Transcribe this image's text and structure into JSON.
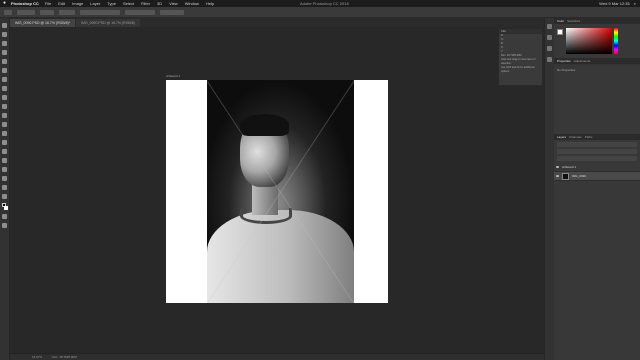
{
  "menubar": {
    "app_name": "Photoshop CC",
    "items": [
      "File",
      "Edit",
      "Image",
      "Layer",
      "Type",
      "Select",
      "Filter",
      "3D",
      "View",
      "Window",
      "Help"
    ],
    "window_title": "Adobe Photoshop CC 2018",
    "clock": "Wed 9 Mar 12:35"
  },
  "tabs": [
    {
      "label": "IMG_0090.PSD @ 16.7% (RGB/8)*"
    },
    {
      "label": "IMG_0090.PSD @ 16.7% (RGB/8)"
    }
  ],
  "artboard": {
    "label": "Artboard 1"
  },
  "info_panel": {
    "title": "Info",
    "rows": [
      "R:",
      "G:",
      "B:",
      "X:",
      "Y:",
      "Doc: 18.7M/8.90M",
      "Click and drag to move layer or selection.",
      "Use Shift and Alt for additional options."
    ]
  },
  "right_panel": {
    "color_tabs": [
      "Color",
      "Swatches"
    ],
    "properties_tabs": [
      "Properties",
      "Adjustments"
    ],
    "properties_text": "No Properties",
    "layers_tabs": [
      "Layers",
      "Channels",
      "Paths"
    ],
    "layers": [
      {
        "name": "Artboard 1",
        "selected": false
      },
      {
        "name": "IMG_0090",
        "selected": true
      }
    ]
  },
  "status": {
    "zoom": "16.67%",
    "doc": "Doc: 18.7M/8.90M"
  },
  "colors": {
    "accent": "#e00000",
    "ui_bg": "#262626"
  }
}
